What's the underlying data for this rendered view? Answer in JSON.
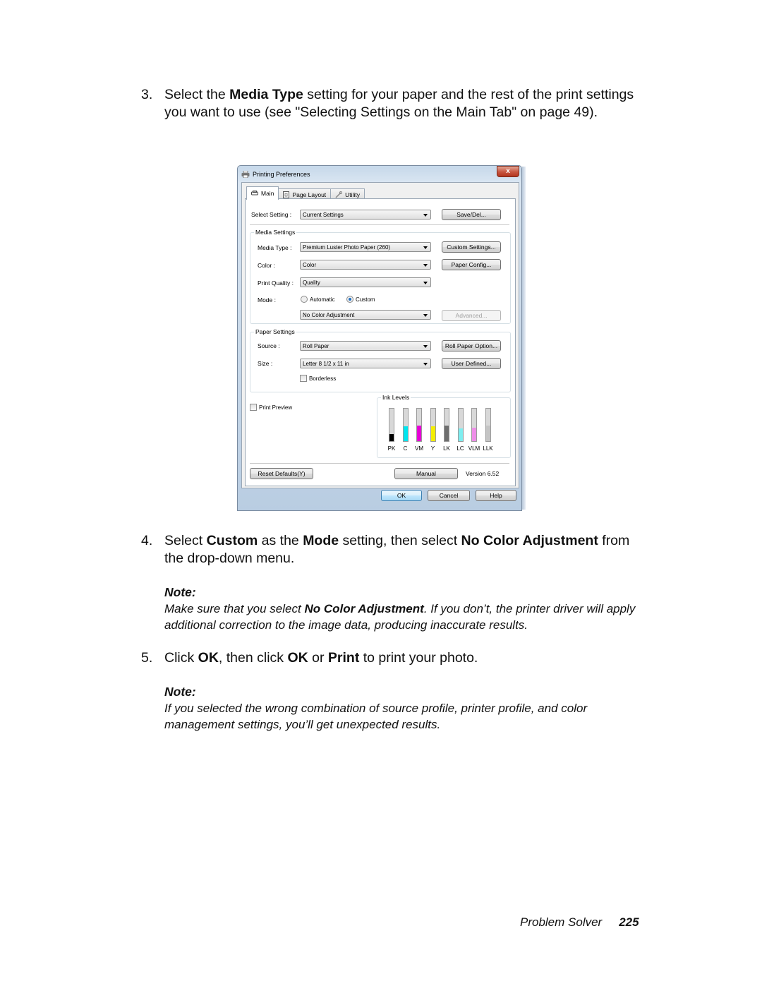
{
  "steps": [
    {
      "number": "3.",
      "segments": [
        {
          "text": "Select the ",
          "bold": false
        },
        {
          "text": "Media Type",
          "bold": true
        },
        {
          "text": " setting for your paper and the rest of the print settings you want to use (see \"Selecting Settings on the Main Tab\" on page 49).",
          "bold": false
        }
      ]
    },
    {
      "number": "4.",
      "segments": [
        {
          "text": "Select ",
          "bold": false
        },
        {
          "text": "Custom",
          "bold": true
        },
        {
          "text": " as the ",
          "bold": false
        },
        {
          "text": "Mode",
          "bold": true
        },
        {
          "text": " setting, then select ",
          "bold": false
        },
        {
          "text": "No Color Adjustment",
          "bold": true
        },
        {
          "text": " from the drop-down menu.",
          "bold": false
        }
      ]
    },
    {
      "number": "5.",
      "segments": [
        {
          "text": "Click ",
          "bold": false
        },
        {
          "text": "OK",
          "bold": true
        },
        {
          "text": ", then click ",
          "bold": false
        },
        {
          "text": "OK",
          "bold": true
        },
        {
          "text": " or ",
          "bold": false
        },
        {
          "text": "Print",
          "bold": true
        },
        {
          "text": " to print your photo.",
          "bold": false
        }
      ]
    }
  ],
  "notes": [
    {
      "title": "Note:",
      "segments": [
        {
          "text": "Make sure that you select ",
          "bold": false
        },
        {
          "text": "No Color Adjustment",
          "bold": true
        },
        {
          "text": ". If you don’t, the printer driver will apply additional correction to the image data, producing inaccurate results.",
          "bold": false
        }
      ]
    },
    {
      "title": "Note:",
      "segments": [
        {
          "text": "If you selected the wrong combination of source profile, printer profile, and color management settings, you’ll get unexpected results.",
          "bold": false
        }
      ]
    }
  ],
  "footer": {
    "section": "Problem Solver",
    "page": "225"
  },
  "dialog": {
    "title": "Printing Preferences",
    "close_label": "x",
    "tabs": [
      {
        "label": "Main",
        "icon": "printer-icon",
        "active": true
      },
      {
        "label": "Page Layout",
        "icon": "page-layout-icon",
        "active": false
      },
      {
        "label": "Utility",
        "icon": "wrench-icon",
        "active": false
      }
    ],
    "select_setting": {
      "label": "Select Setting :",
      "value": "Current Settings",
      "button": "Save/Del..."
    },
    "media_settings": {
      "group_label": "Media Settings",
      "media_type": {
        "label": "Media Type :",
        "value": "Premium Luster Photo Paper (260)",
        "button": "Custom Settings..."
      },
      "color": {
        "label": "Color :",
        "value": "Color",
        "button": "Paper Config..."
      },
      "print_quality": {
        "label": "Print Quality :",
        "value": "Quality"
      },
      "mode": {
        "label": "Mode :",
        "options": [
          {
            "label": "Automatic",
            "selected": false
          },
          {
            "label": "Custom",
            "selected": true
          }
        ],
        "value": "No Color Adjustment",
        "button": "Advanced...",
        "button_enabled": false
      }
    },
    "paper_settings": {
      "group_label": "Paper Settings",
      "source": {
        "label": "Source :",
        "value": "Roll Paper",
        "button": "Roll Paper Option..."
      },
      "size": {
        "label": "Size :",
        "value": "Letter 8 1/2 x 11 in",
        "button": "User Defined..."
      },
      "borderless": {
        "label": "Borderless",
        "checked": false
      }
    },
    "print_preview": {
      "label": "Print Preview",
      "checked": false
    },
    "ink_levels": {
      "group_label": "Ink Levels",
      "inks": [
        {
          "name": "PK",
          "level_pct": 22,
          "color": "#000000"
        },
        {
          "name": "C",
          "level_pct": 45,
          "color": "#00e5ee"
        },
        {
          "name": "VM",
          "level_pct": 48,
          "color": "#e600d6"
        },
        {
          "name": "Y",
          "level_pct": 45,
          "color": "#f4ee00"
        },
        {
          "name": "LK",
          "level_pct": 48,
          "color": "#6e6e6e"
        },
        {
          "name": "LC",
          "level_pct": 40,
          "color": "#7eeef0"
        },
        {
          "name": "VLM",
          "level_pct": 42,
          "color": "#ee8ee8"
        },
        {
          "name": "LLK",
          "level_pct": 48,
          "color": "#c4c4c4"
        }
      ]
    },
    "reset_defaults": "Reset Defaults(Y)",
    "manual": "Manual",
    "version": "Version 6.52",
    "ok": "OK",
    "cancel": "Cancel",
    "help": "Help"
  }
}
